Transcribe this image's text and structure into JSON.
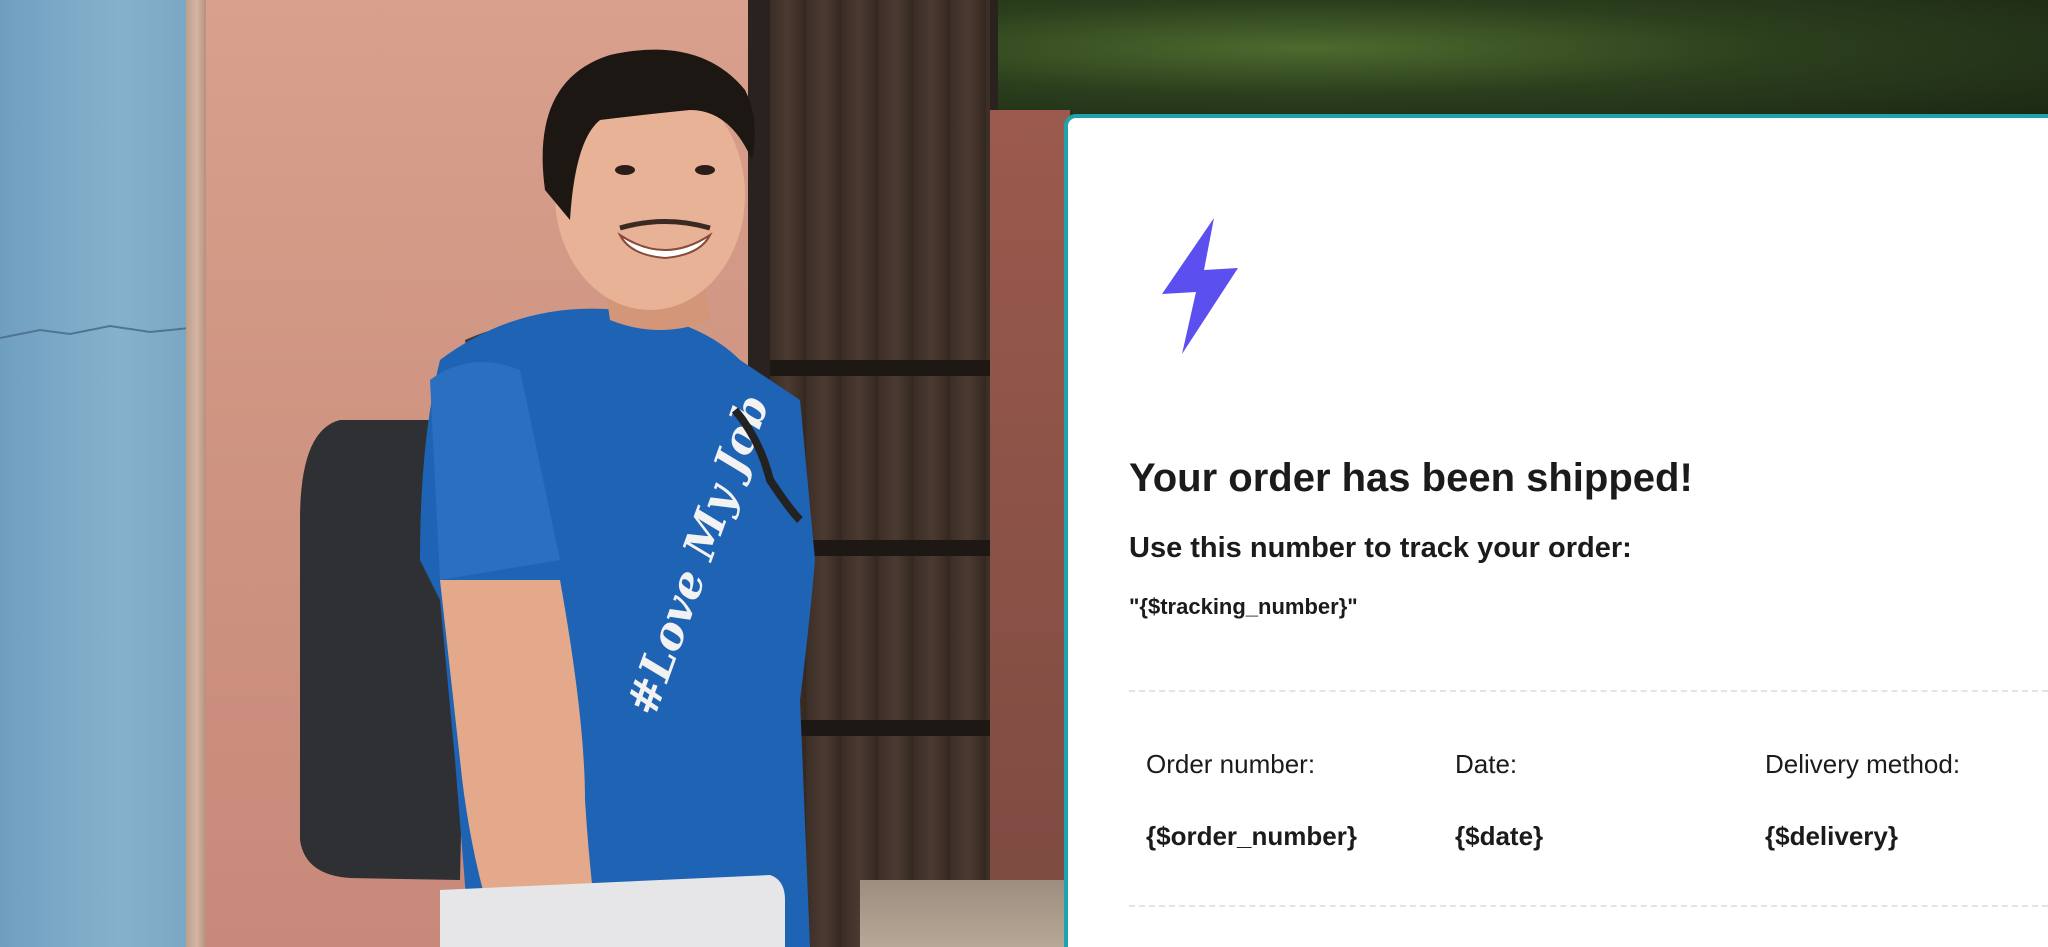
{
  "email": {
    "logo_icon": "lightning-bolt-icon",
    "accent_color": "#1ea3ad",
    "logo_color": "#5b4ff0",
    "headline": "Your order has been shipped!",
    "subheadline": "Use this number to track your order:",
    "tracking_placeholder": "\"{$tracking_number}\"",
    "details": [
      {
        "label": "Order number:",
        "value": "{$order_number}"
      },
      {
        "label": "Date:",
        "value": "{$date}"
      },
      {
        "label": "Delivery method:",
        "value": "{$delivery}"
      }
    ]
  },
  "background": {
    "photo_subject": "smiling man with backpack in blue t-shirt",
    "shirt_text": "#Love My Job"
  }
}
